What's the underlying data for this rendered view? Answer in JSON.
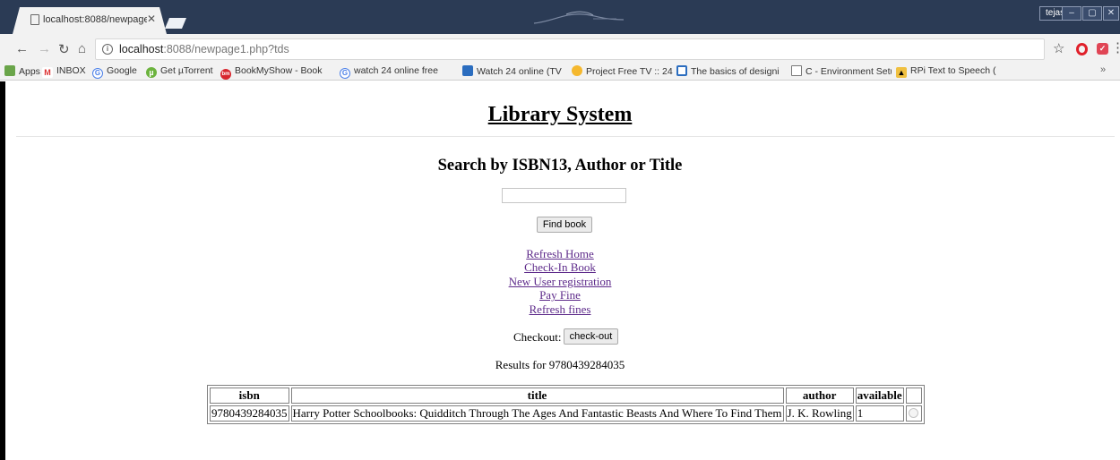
{
  "browser": {
    "tab_title": "localhost:8088/newpage",
    "user_name": "tejas",
    "url_host": "localhost",
    "url_rest": ":8088/newpage1.php?tds",
    "bookmarks": [
      "Apps",
      "INBOX",
      "Google",
      "Get µTorrent",
      "BookMyShow - Book",
      "watch 24 online free",
      "Watch 24 online (TV",
      "Project Free TV :: 24",
      "The basics of designi",
      "C - Environment Setu",
      "RPi Text to Speech (S"
    ],
    "bookmarks_more": "»"
  },
  "page": {
    "title": "Library System",
    "search_heading": "Search by ISBN13, Author or Title",
    "search_value": "",
    "find_button": "Find book",
    "links": [
      "Refresh Home",
      "Check-In Book",
      "New User registration",
      "Pay Fine",
      "Refresh fines"
    ],
    "checkout_label": "Checkout:",
    "checkout_button": "check-out",
    "results_text": "Results for 9780439284035",
    "table": {
      "headers": [
        "isbn",
        "title",
        "author",
        "available",
        ""
      ],
      "rows": [
        [
          "9780439284035",
          "Harry Potter Schoolbooks: Quidditch Through The Ages And Fantastic Beasts And Where To Find Them",
          "J. K. Rowling",
          "1"
        ]
      ]
    }
  },
  "colors": {
    "titlebar": "#2b3b55",
    "link_visited": "#5d2a8a"
  }
}
